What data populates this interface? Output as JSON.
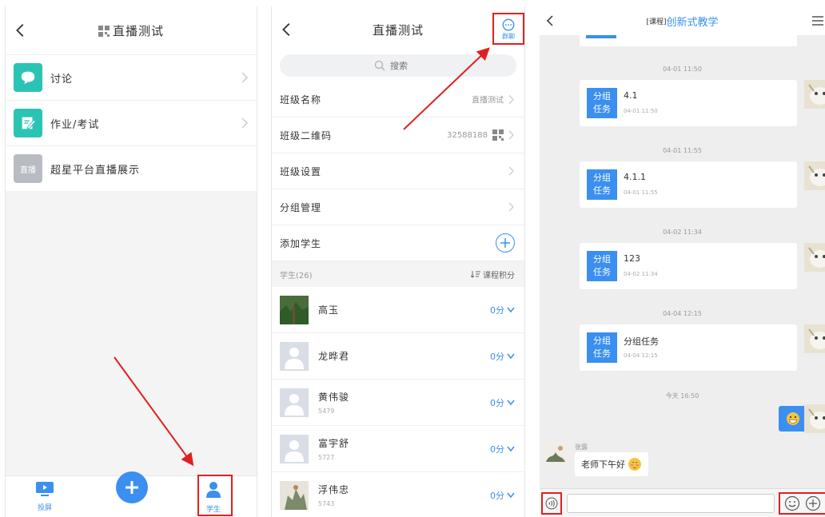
{
  "colors": {
    "accent": "#3a8ff0",
    "highlight": "#e02020",
    "teal": "#2bc4b4"
  },
  "panel1": {
    "title": "直播测试",
    "items": [
      {
        "label": "讨论",
        "icon": "chat-bubble-icon",
        "color": "#2bc4b4"
      },
      {
        "label": "作业/考试",
        "icon": "edit-note-icon",
        "color": "#2bc4b4"
      },
      {
        "label": "超星平台直播展示",
        "icon_text": "直播",
        "color": "#b8bcc2"
      }
    ],
    "tabs": [
      {
        "label": "投屏",
        "icon": "screen-cast-icon"
      },
      {
        "label": "学生",
        "icon": "student-person-icon"
      }
    ]
  },
  "panel2": {
    "title": "直播测试",
    "group_chat_label": "群聊",
    "search_placeholder": "搜索",
    "rows": [
      {
        "label": "班级名称",
        "value": "直播测试"
      },
      {
        "label": "班级二维码",
        "value": "32588188"
      },
      {
        "label": "班级设置",
        "value": ""
      },
      {
        "label": "分组管理",
        "value": ""
      },
      {
        "label": "添加学生",
        "value": ""
      }
    ],
    "students_header": "学生(26)",
    "sort_label": "课程积分",
    "students": [
      {
        "name": "高玉",
        "id": "",
        "score": "0分",
        "avatar": "photo-trees"
      },
      {
        "name": "龙晔君",
        "id": "",
        "score": "0分",
        "avatar": "default"
      },
      {
        "name": "黄伟骏",
        "id": "5479",
        "score": "0分",
        "avatar": "default"
      },
      {
        "name": "富宇舒",
        "id": "5727",
        "score": "0分",
        "avatar": "default"
      },
      {
        "name": "浮伟忠",
        "id": "5743",
        "score": "0分",
        "avatar": "photo-painting"
      }
    ]
  },
  "panel3": {
    "title_tag": "[课程]",
    "title": "创新式教学",
    "messages": [
      {
        "time": "04-01 11:50",
        "badge": [
          "分组",
          "任务"
        ],
        "title": "4.1",
        "card_time": "04-01 11:50"
      },
      {
        "time": "04-01 11:55",
        "badge": [
          "分组",
          "任务"
        ],
        "title": "4.1.1",
        "card_time": "04-01 11:55"
      },
      {
        "time": "04-02 11:34",
        "badge": [
          "分组",
          "任务"
        ],
        "title": "123",
        "card_time": "04-02 11:34"
      },
      {
        "time": "04-04 12:15",
        "badge": [
          "分组",
          "任务"
        ],
        "title": "分组任务",
        "card_time": "04-04 12:15"
      }
    ],
    "today_time": "今天 16:50",
    "other_name": "张露",
    "other_message": "老师下午好"
  }
}
